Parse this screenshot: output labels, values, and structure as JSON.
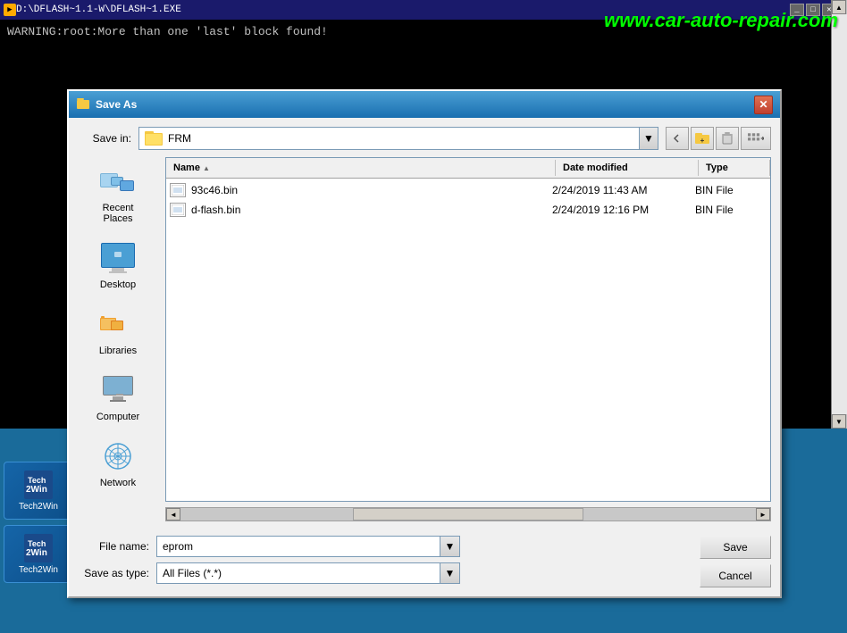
{
  "terminal": {
    "title": "D:\\DFLASH~1.1-W\\DFLASH~1.EXE",
    "warning_line": "WARNING:root:More than one 'last' block found!"
  },
  "watermark": {
    "text": "www.car-auto-repair.com"
  },
  "dialog": {
    "title": "Save As",
    "save_in_label": "Save in:",
    "save_in_value": "FRM",
    "col_name": "Name",
    "col_date": "Date modified",
    "col_type": "Type",
    "files": [
      {
        "name": "93c46.bin",
        "date": "2/24/2019 11:43 AM",
        "type": "BIN File"
      },
      {
        "name": "d-flash.bin",
        "date": "2/24/2019 12:16 PM",
        "type": "BIN File"
      }
    ],
    "file_name_label": "File name:",
    "file_name_value": "eprom",
    "save_as_type_label": "Save as type:",
    "save_as_type_value": "All Files (*.*)",
    "save_button": "Save",
    "cancel_button": "Cancel"
  },
  "sidebar": {
    "items": [
      {
        "label": "Recent Places"
      },
      {
        "label": "Desktop"
      },
      {
        "label": "Libraries"
      },
      {
        "label": "Computer"
      },
      {
        "label": "Network"
      }
    ]
  },
  "taskbar": {
    "items": [
      {
        "label": "Tech2Win"
      },
      {
        "label": "Tech2Win"
      }
    ]
  }
}
